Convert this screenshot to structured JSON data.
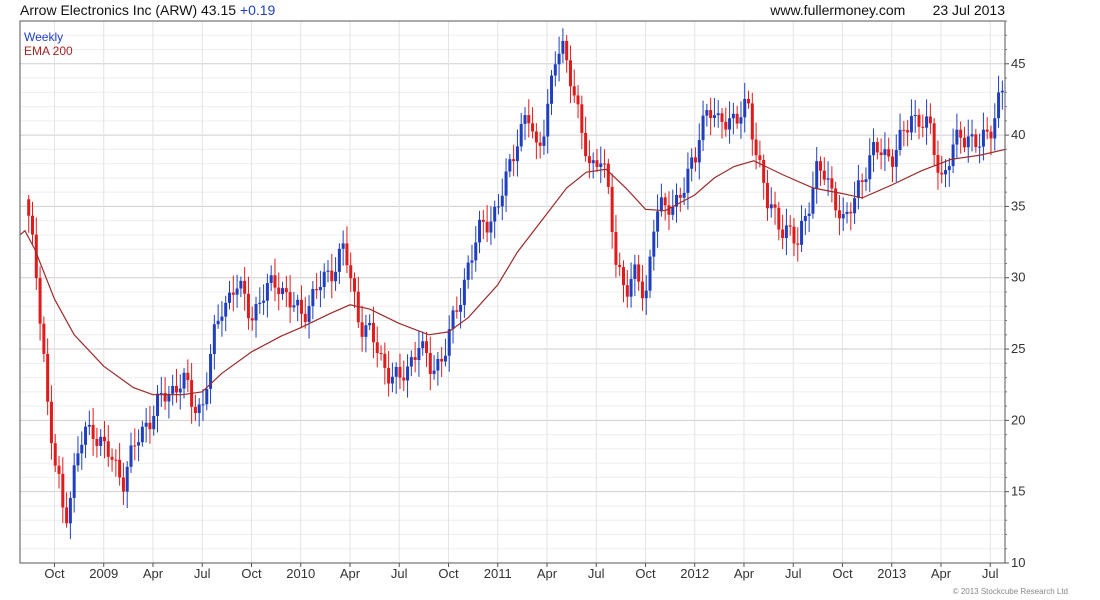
{
  "header": {
    "title": "Arrow Electronics Inc (ARW) 43.15",
    "change": "+0.19",
    "site": "www.fullermoney.com",
    "date": "23 Jul 2013"
  },
  "legend": {
    "weekly": "Weekly",
    "ema": "EMA 200"
  },
  "footer": {
    "copyright": "© 2013 Stockcube Research Ltd"
  },
  "colors": {
    "up": "#1f3fbf",
    "down": "#e01b1b",
    "ema": "#9b2a2a",
    "grid": "#d9d9d9"
  },
  "chart_data": {
    "type": "candlestick",
    "title": "Arrow Electronics Inc (ARW) 43.15 +0.19",
    "xlabel": "",
    "ylabel": "",
    "ylim": [
      10,
      48
    ],
    "y_axis_side": "right",
    "grid": true,
    "y_ticks": [
      10,
      15,
      20,
      25,
      30,
      35,
      40,
      45
    ],
    "x_ticks": [
      {
        "t": 0.75,
        "label": "Oct"
      },
      {
        "t": 1.0,
        "label": "2009"
      },
      {
        "t": 1.25,
        "label": "Apr"
      },
      {
        "t": 1.5,
        "label": "Jul"
      },
      {
        "t": 1.75,
        "label": "Oct"
      },
      {
        "t": 2.0,
        "label": "2010"
      },
      {
        "t": 2.25,
        "label": "Apr"
      },
      {
        "t": 2.5,
        "label": "Jul"
      },
      {
        "t": 2.75,
        "label": "Oct"
      },
      {
        "t": 3.0,
        "label": "2011"
      },
      {
        "t": 3.25,
        "label": "Apr"
      },
      {
        "t": 3.5,
        "label": "Jul"
      },
      {
        "t": 3.75,
        "label": "Oct"
      },
      {
        "t": 4.0,
        "label": "2012"
      },
      {
        "t": 4.25,
        "label": "Apr"
      },
      {
        "t": 4.5,
        "label": "Jul"
      },
      {
        "t": 4.75,
        "label": "Oct"
      },
      {
        "t": 5.0,
        "label": "2013"
      },
      {
        "t": 5.25,
        "label": "Apr"
      },
      {
        "t": 5.5,
        "label": "Jul"
      }
    ],
    "t_range": [
      0.575,
      5.575
    ],
    "price_path": [
      {
        "t": 0.6,
        "y": 35.5
      },
      {
        "t": 0.63,
        "y": 33
      },
      {
        "t": 0.66,
        "y": 30
      },
      {
        "t": 0.69,
        "y": 26
      },
      {
        "t": 0.72,
        "y": 20
      },
      {
        "t": 0.75,
        "y": 17
      },
      {
        "t": 0.78,
        "y": 15
      },
      {
        "t": 0.8,
        "y": 13
      },
      {
        "t": 0.83,
        "y": 15
      },
      {
        "t": 0.86,
        "y": 17
      },
      {
        "t": 0.9,
        "y": 19
      },
      {
        "t": 0.95,
        "y": 19.5
      },
      {
        "t": 1.0,
        "y": 18
      },
      {
        "t": 1.05,
        "y": 17
      },
      {
        "t": 1.1,
        "y": 16
      },
      {
        "t": 1.17,
        "y": 18.5
      },
      {
        "t": 1.22,
        "y": 20
      },
      {
        "t": 1.3,
        "y": 21.5
      },
      {
        "t": 1.4,
        "y": 23
      },
      {
        "t": 1.45,
        "y": 21
      },
      {
        "t": 1.5,
        "y": 21
      },
      {
        "t": 1.55,
        "y": 25
      },
      {
        "t": 1.6,
        "y": 28
      },
      {
        "t": 1.67,
        "y": 29.5
      },
      {
        "t": 1.75,
        "y": 27.5
      },
      {
        "t": 1.83,
        "y": 29
      },
      {
        "t": 1.88,
        "y": 30
      },
      {
        "t": 1.95,
        "y": 28
      },
      {
        "t": 2.0,
        "y": 27.5
      },
      {
        "t": 2.08,
        "y": 29
      },
      {
        "t": 2.15,
        "y": 30.5
      },
      {
        "t": 2.22,
        "y": 32
      },
      {
        "t": 2.25,
        "y": 30
      },
      {
        "t": 2.3,
        "y": 27
      },
      {
        "t": 2.35,
        "y": 26
      },
      {
        "t": 2.42,
        "y": 24
      },
      {
        "t": 2.5,
        "y": 22.5
      },
      {
        "t": 2.55,
        "y": 24
      },
      {
        "t": 2.6,
        "y": 25.5
      },
      {
        "t": 2.65,
        "y": 23.5
      },
      {
        "t": 2.72,
        "y": 24.5
      },
      {
        "t": 2.78,
        "y": 27
      },
      {
        "t": 2.85,
        "y": 31
      },
      {
        "t": 2.92,
        "y": 33.5
      },
      {
        "t": 3.0,
        "y": 35
      },
      {
        "t": 3.05,
        "y": 37
      },
      {
        "t": 3.1,
        "y": 40
      },
      {
        "t": 3.15,
        "y": 41.5
      },
      {
        "t": 3.2,
        "y": 38.5
      },
      {
        "t": 3.25,
        "y": 42
      },
      {
        "t": 3.3,
        "y": 45.5
      },
      {
        "t": 3.33,
        "y": 46
      },
      {
        "t": 3.38,
        "y": 44
      },
      {
        "t": 3.43,
        "y": 39.5
      },
      {
        "t": 3.47,
        "y": 37.5
      },
      {
        "t": 3.52,
        "y": 39
      },
      {
        "t": 3.55,
        "y": 37
      },
      {
        "t": 3.6,
        "y": 31
      },
      {
        "t": 3.65,
        "y": 29.5
      },
      {
        "t": 3.7,
        "y": 30
      },
      {
        "t": 3.75,
        "y": 28.5
      },
      {
        "t": 3.8,
        "y": 35
      },
      {
        "t": 3.85,
        "y": 34.5
      },
      {
        "t": 3.9,
        "y": 35.5
      },
      {
        "t": 3.95,
        "y": 36.5
      },
      {
        "t": 4.0,
        "y": 38
      },
      {
        "t": 4.03,
        "y": 41
      },
      {
        "t": 4.07,
        "y": 42
      },
      {
        "t": 4.12,
        "y": 40.5
      },
      {
        "t": 4.17,
        "y": 41.5
      },
      {
        "t": 4.22,
        "y": 41
      },
      {
        "t": 4.27,
        "y": 42
      },
      {
        "t": 4.33,
        "y": 38
      },
      {
        "t": 4.37,
        "y": 35
      },
      {
        "t": 4.42,
        "y": 34
      },
      {
        "t": 4.47,
        "y": 33.5
      },
      {
        "t": 4.52,
        "y": 32
      },
      {
        "t": 4.57,
        "y": 35
      },
      {
        "t": 4.62,
        "y": 37.5
      },
      {
        "t": 4.66,
        "y": 37
      },
      {
        "t": 4.72,
        "y": 35.5
      },
      {
        "t": 4.76,
        "y": 33.5
      },
      {
        "t": 4.8,
        "y": 35
      },
      {
        "t": 4.84,
        "y": 37
      },
      {
        "t": 4.9,
        "y": 38.5
      },
      {
        "t": 4.95,
        "y": 39
      },
      {
        "t": 5.0,
        "y": 38.5
      },
      {
        "t": 5.05,
        "y": 39.5
      },
      {
        "t": 5.1,
        "y": 41.5
      },
      {
        "t": 5.15,
        "y": 41
      },
      {
        "t": 5.2,
        "y": 40
      },
      {
        "t": 5.25,
        "y": 37
      },
      {
        "t": 5.3,
        "y": 38.5
      },
      {
        "t": 5.35,
        "y": 40
      },
      {
        "t": 5.4,
        "y": 40
      },
      {
        "t": 5.45,
        "y": 39
      },
      {
        "t": 5.5,
        "y": 40.5
      },
      {
        "t": 5.55,
        "y": 43
      },
      {
        "t": 5.575,
        "y": 43.15
      }
    ],
    "series": [
      {
        "name": "EMA 200",
        "type": "line",
        "points": [
          {
            "t": 0.575,
            "y": 33.0
          },
          {
            "t": 0.6,
            "y": 33.3
          },
          {
            "t": 0.65,
            "y": 32.0
          },
          {
            "t": 0.75,
            "y": 28.5
          },
          {
            "t": 0.85,
            "y": 26.0
          },
          {
            "t": 1.0,
            "y": 23.8
          },
          {
            "t": 1.15,
            "y": 22.3
          },
          {
            "t": 1.25,
            "y": 21.8
          },
          {
            "t": 1.4,
            "y": 21.8
          },
          {
            "t": 1.5,
            "y": 22.0
          },
          {
            "t": 1.6,
            "y": 23.3
          },
          {
            "t": 1.75,
            "y": 24.8
          },
          {
            "t": 1.9,
            "y": 25.9
          },
          {
            "t": 2.0,
            "y": 26.5
          },
          {
            "t": 2.15,
            "y": 27.5
          },
          {
            "t": 2.25,
            "y": 28.1
          },
          {
            "t": 2.35,
            "y": 27.8
          },
          {
            "t": 2.5,
            "y": 26.8
          },
          {
            "t": 2.65,
            "y": 26.0
          },
          {
            "t": 2.75,
            "y": 26.2
          },
          {
            "t": 2.85,
            "y": 27.2
          },
          {
            "t": 3.0,
            "y": 29.5
          },
          {
            "t": 3.1,
            "y": 31.8
          },
          {
            "t": 3.25,
            "y": 34.5
          },
          {
            "t": 3.35,
            "y": 36.3
          },
          {
            "t": 3.45,
            "y": 37.4
          },
          {
            "t": 3.55,
            "y": 37.6
          },
          {
            "t": 3.65,
            "y": 36.3
          },
          {
            "t": 3.75,
            "y": 34.8
          },
          {
            "t": 3.85,
            "y": 34.7
          },
          {
            "t": 4.0,
            "y": 35.8
          },
          {
            "t": 4.1,
            "y": 37.0
          },
          {
            "t": 4.2,
            "y": 37.8
          },
          {
            "t": 4.3,
            "y": 38.2
          },
          {
            "t": 4.45,
            "y": 37.2
          },
          {
            "t": 4.6,
            "y": 36.3
          },
          {
            "t": 4.75,
            "y": 35.9
          },
          {
            "t": 4.85,
            "y": 35.6
          },
          {
            "t": 5.0,
            "y": 36.5
          },
          {
            "t": 5.15,
            "y": 37.5
          },
          {
            "t": 5.3,
            "y": 38.3
          },
          {
            "t": 5.45,
            "y": 38.6
          },
          {
            "t": 5.575,
            "y": 39.0
          }
        ]
      }
    ]
  }
}
